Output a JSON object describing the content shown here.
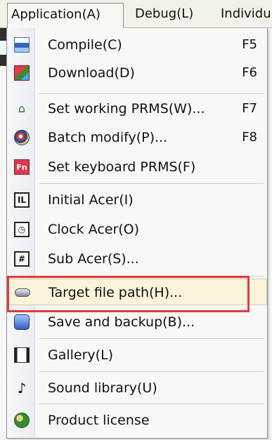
{
  "menubar": {
    "items": [
      {
        "label": "Application(A)"
      },
      {
        "label": "Debug(L)"
      },
      {
        "label": "Individu"
      }
    ]
  },
  "menu": {
    "items": [
      {
        "label": "Compile(C)",
        "shortcut": "F5",
        "icon": "compile-icon"
      },
      {
        "label": "Download(D)",
        "shortcut": "F6",
        "icon": "download-icon"
      },
      {
        "label": "Set working PRMS(W)...",
        "shortcut": "F7",
        "icon": "house-icon"
      },
      {
        "label": "Batch modify(P)...",
        "shortcut": "F8",
        "icon": "batch-modify-icon"
      },
      {
        "label": "Set keyboard PRMS(F)",
        "shortcut": "",
        "icon": "keyboard-icon"
      },
      {
        "label": "Initial Acer(I)",
        "shortcut": "",
        "icon": "initial-acer-icon"
      },
      {
        "label": "Clock Acer(O)",
        "shortcut": "",
        "icon": "clock-acer-icon"
      },
      {
        "label": "Sub Acer(S)...",
        "shortcut": "",
        "icon": "sub-acer-icon"
      },
      {
        "label": "Target file path(H)...",
        "shortcut": "",
        "icon": "target-file-path-icon"
      },
      {
        "label": "Save and backup(B)...",
        "shortcut": "",
        "icon": "save-backup-icon"
      },
      {
        "label": "Gallery(L)",
        "shortcut": "",
        "icon": "gallery-icon"
      },
      {
        "label": "Sound library(U)",
        "shortcut": "",
        "icon": "sound-library-icon"
      },
      {
        "label": "Product license",
        "shortcut": "",
        "icon": "product-license-icon"
      }
    ]
  },
  "icon_glyphs": {
    "house": "⌂",
    "keyboard": "Fn",
    "initial": "IL",
    "clock": "◷",
    "hash": "#",
    "note": "♪"
  },
  "colors": {
    "highlight_box": "#e33a3f",
    "highlight_row": "#fbf4db"
  }
}
